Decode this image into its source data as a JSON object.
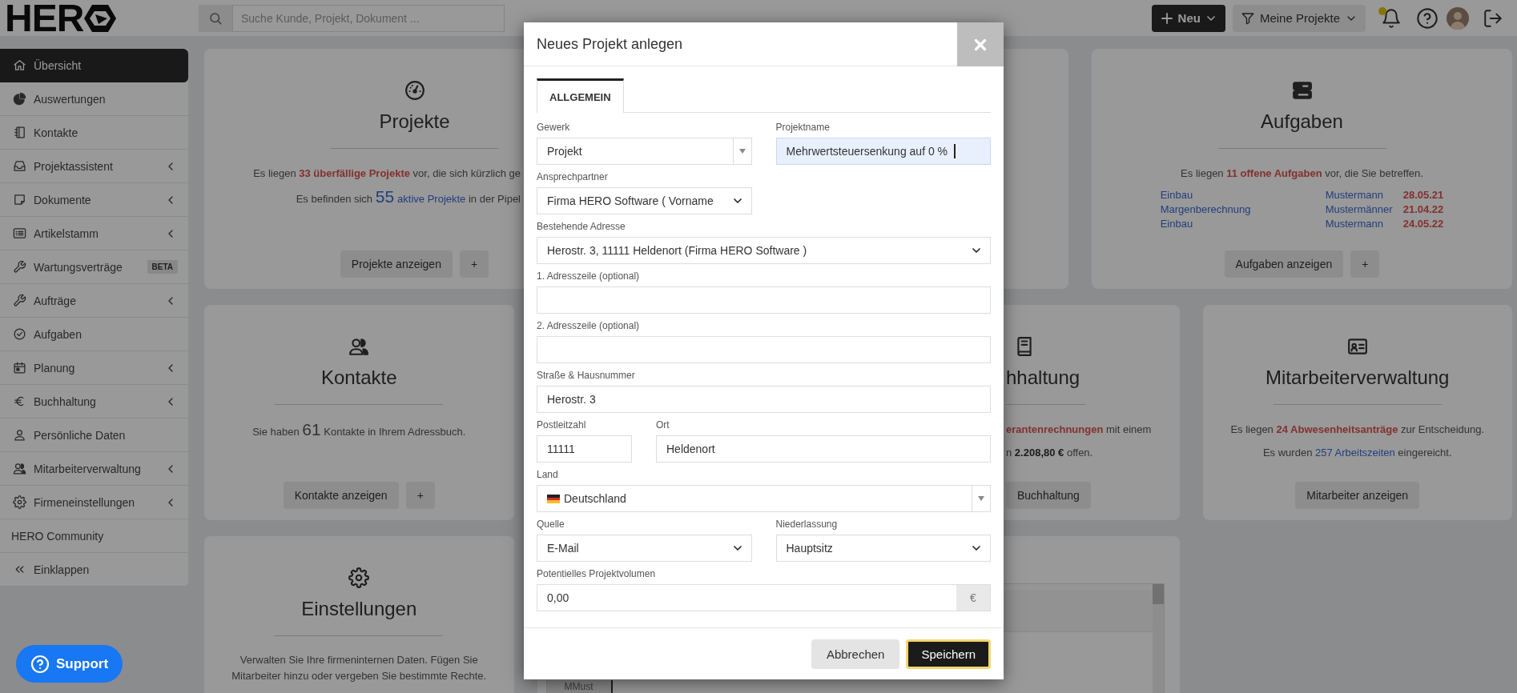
{
  "topbar": {
    "logo": "HER",
    "search": {
      "placeholder": "Suche Kunde, Projekt, Dokument ..."
    },
    "new_button": "Neu",
    "filter_button": "Meine Projekte",
    "notifications": {
      "unread": true
    }
  },
  "sidebar": {
    "items": [
      {
        "label": "Übersicht",
        "selected": true,
        "submenu": false
      },
      {
        "label": "Auswertungen",
        "selected": false,
        "submenu": false
      },
      {
        "label": "Kontakte",
        "selected": false,
        "submenu": false
      },
      {
        "label": "Projektassistent",
        "selected": false,
        "submenu": true
      },
      {
        "label": "Dokumente",
        "selected": false,
        "submenu": true
      },
      {
        "label": "Artikelstamm",
        "selected": false,
        "submenu": true
      },
      {
        "label": "Wartungsverträge",
        "selected": false,
        "submenu": false,
        "badge": "BETA"
      },
      {
        "label": "Aufträge",
        "selected": false,
        "submenu": true
      },
      {
        "label": "Aufgaben",
        "selected": false,
        "submenu": false
      },
      {
        "label": "Planung",
        "selected": false,
        "submenu": true
      },
      {
        "label": "Buchhaltung",
        "selected": false,
        "submenu": true
      },
      {
        "label": "Persönliche Daten",
        "selected": false,
        "submenu": false
      },
      {
        "label": "Mitarbeiterverwaltung",
        "selected": false,
        "submenu": true
      },
      {
        "label": "Firmeneinstellungen",
        "selected": false,
        "submenu": true
      },
      {
        "label": "HERO Community",
        "selected": false,
        "submenu": false
      },
      {
        "label": "Einklappen",
        "selected": false,
        "submenu": false
      }
    ]
  },
  "dashboard": {
    "rows": [
      {
        "cards": [
          {
            "kind": "leftpart",
            "title": "Projekte",
            "lines": [
              [
                {
                  "text": "Es liegen ",
                  "kind": "plain"
                },
                {
                  "text": "33 überfällige Projekte",
                  "kind": "alert"
                },
                {
                  "text": " vor, die sich kürzlich ge",
                  "kind": "plain"
                }
              ],
              [
                {
                  "text": "Es befinden sich ",
                  "kind": "plain"
                },
                {
                  "text": "55",
                  "kind": "biglink"
                },
                {
                  "text": "aktive Projekte",
                  "kind": "link"
                },
                {
                  "text": " in der Pipel",
                  "kind": "plain"
                }
              ]
            ],
            "buttons": [
              "Projekte anzeigen",
              "+"
            ]
          },
          {
            "kind": "blank"
          },
          {
            "kind": "summary",
            "title": "Aufgaben",
            "lines": [
              [
                {
                  "text": "Es liegen ",
                  "kind": "plain"
                },
                {
                  "text": "11 offene Aufgaben",
                  "kind": "alert"
                },
                {
                  "text": " vor, die Sie betreffen.",
                  "kind": "plain"
                }
              ]
            ],
            "tasks": [
              {
                "name": "Einbau",
                "person": "Mustermann",
                "date": "28.05.21"
              },
              {
                "name": "Margenberechnung",
                "person": "Mustermänner",
                "date": "21.04.22"
              },
              {
                "name": "Einbau",
                "person": "Mustermann",
                "date": "24.05.22"
              }
            ],
            "buttons": [
              "Aufgaben anzeigen",
              "+"
            ]
          }
        ]
      },
      {
        "cards": [
          {
            "kind": "summary",
            "title": "Kontakte",
            "lines": [
              [
                {
                  "text": "Sie haben ",
                  "kind": "plain"
                },
                {
                  "text": "61",
                  "kind": "big"
                },
                {
                  "text": " Kontakte in Ihrem Adressbuch.",
                  "kind": "plain"
                }
              ]
            ],
            "buttons": [
              "Kontakte anzeigen",
              "+"
            ]
          },
          {
            "kind": "rightpart",
            "title": "hhaltung",
            "lines": [
              [
                {
                  "text": "erantenrechnungen",
                  "kind": "alert"
                },
                {
                  "text": " mit einem",
                  "kind": "plain"
                }
              ],
              [
                {
                  "text": "n ",
                  "kind": "plain"
                },
                {
                  "text": "2.208,80 €",
                  "kind": "strong"
                },
                {
                  "text": " offen.",
                  "kind": "plain"
                }
              ]
            ],
            "buttons": [
              "Buchhaltung"
            ]
          },
          {
            "kind": "summary",
            "title": "Mitarbeiterverwaltung",
            "lines": [
              [
                {
                  "text": "Es liegen ",
                  "kind": "plain"
                },
                {
                  "text": "24 Abwesenheitsanträge",
                  "kind": "alert"
                },
                {
                  "text": " zur Entscheidung.",
                  "kind": "plain"
                }
              ],
              [
                {
                  "text": "Es wurden ",
                  "kind": "plain"
                },
                {
                  "text": "257 Arbeitszeiten",
                  "kind": "link"
                },
                {
                  "text": " eingereicht.",
                  "kind": "plain"
                }
              ]
            ],
            "buttons": [
              "Mitarbeiter anzeigen"
            ]
          }
        ]
      },
      {
        "cards": [
          {
            "kind": "summary",
            "title": "Einstellungen",
            "lines": [
              [
                {
                  "text": "Verwalten Sie Ihre firmeninternen Daten. Fügen Sie Mitarbeiter hinzu oder vergeben Sie bestimmte Rechte.",
                  "kind": "plain"
                }
              ]
            ]
          },
          {
            "kind": "activity",
            "author": "MMust"
          }
        ]
      }
    ]
  },
  "modal": {
    "title": "Neues Projekt anlegen",
    "tabs": [
      {
        "label": "ALLGEMEIN",
        "selected": true
      }
    ],
    "rows": [
      [
        {
          "label": "Gewerk",
          "kind": "combo",
          "value": "Projekt",
          "focused": false
        },
        {
          "label": "Projektname",
          "kind": "text",
          "value": "Mehrwertsteuersenkung auf 0 %",
          "focused": true
        }
      ],
      [
        {
          "label": "Ansprechpartner",
          "kind": "select",
          "value": "Firma HERO Software ( Vorname",
          "focused": false
        }
      ],
      [
        {
          "label": "Bestehende Adresse",
          "kind": "select",
          "value": "Herostr. 3, 11111 Heldenort (Firma HERO Software )",
          "focused": false
        }
      ],
      [
        {
          "label": "1. Adresszeile (optional)",
          "kind": "text",
          "focused": false
        }
      ],
      [
        {
          "label": "2. Adresszeile (optional)",
          "kind": "text",
          "focused": false
        }
      ],
      [
        {
          "label": "Straße & Hausnummer",
          "kind": "text",
          "value": "Herostr. 3",
          "focused": false
        }
      ],
      [
        {
          "label": "Postleitzahl",
          "kind": "text",
          "value": "11111",
          "focused": false
        },
        {
          "label": "Ort",
          "kind": "text",
          "value": "Heldenort",
          "focused": false
        }
      ],
      [
        {
          "label": "Land",
          "kind": "country",
          "value": "Deutschland",
          "focused": false
        }
      ],
      [
        {
          "label": "Quelle",
          "kind": "select",
          "value": "E-Mail",
          "focused": false
        },
        {
          "label": "Niederlassung",
          "kind": "select",
          "value": "Hauptsitz",
          "focused": false
        }
      ],
      [
        {
          "label": "Potentielles Projektvolumen",
          "kind": "amount",
          "value": "0,00",
          "addon": "€",
          "focused": false
        }
      ]
    ],
    "buttons": [
      {
        "label": "Abbrechen",
        "kind": "secondary",
        "focused": false
      },
      {
        "label": "Speichern",
        "kind": "primary",
        "focused": true
      }
    ]
  },
  "support_button": "Support"
}
